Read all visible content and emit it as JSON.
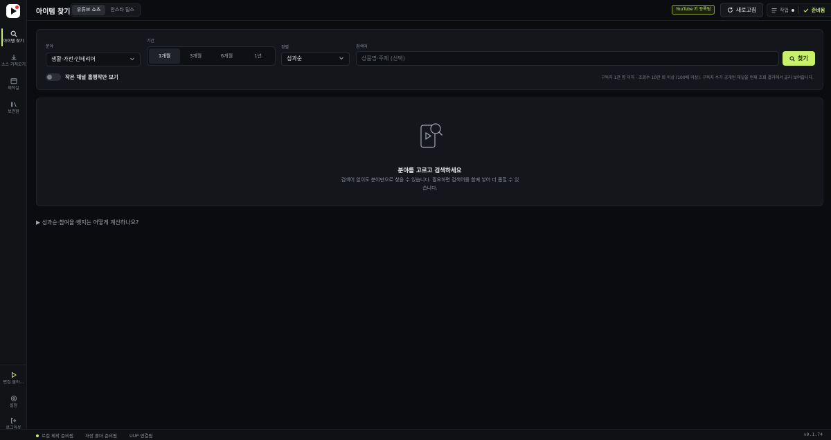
{
  "sidebar": {
    "items": [
      {
        "label": "아이템 찾기",
        "icon": "search-icon"
      },
      {
        "label": "소스 가져오기",
        "icon": "download-icon"
      },
      {
        "label": "제작실",
        "icon": "calendar-icon"
      },
      {
        "label": "보관함",
        "icon": "library-icon"
      }
    ],
    "bottom": [
      {
        "label": "편집 둘아…",
        "icon": "play-icon"
      },
      {
        "label": "설정",
        "icon": "gear-icon"
      },
      {
        "label": "로그아웃",
        "icon": "logout-icon"
      }
    ],
    "accent": "#c9f06a"
  },
  "header": {
    "title": "아이템 찾기",
    "tabs": [
      {
        "label": "유튜브 쇼츠"
      },
      {
        "label": "인스타 릴스"
      }
    ],
    "youtube_badge": "YouTube 키 등록됨",
    "refresh_label": "새로고침",
    "task_label": "작업",
    "status_label": "준비됨"
  },
  "filters": {
    "category_label": "분야",
    "category_value": "생활·가전·인테리어",
    "period_label": "기간",
    "periods": [
      {
        "label": "1개월"
      },
      {
        "label": "3개월"
      },
      {
        "label": "6개월"
      },
      {
        "label": "1년"
      }
    ],
    "sort_label": "정렬",
    "sort_value": "성과순",
    "keyword_label": "검색어",
    "keyword_placeholder": "상품명·주제 (선택)",
    "find_label": "찾기",
    "toggle_label": "작은 채널 홈행작만 보기",
    "hint": "구독자 1천 명 이하 · 조회수 10만 회 이상 (100배 이상). 구독자 수가 공개된 채널을 현재 조회 결과에서 골라 보여줍니다."
  },
  "empty_state": {
    "title": "분야를 고르고 검색하세요",
    "description": "검색어 없이도 분야만으로 찾을 수 있습니다. 필요하면 검색어를 함께 넣어 더 좁힐 수 있습니다."
  },
  "faq": {
    "label": "▶ 성과순·참여율·벳지는 어떻게 계산하나요?"
  },
  "statusbar": {
    "items": [
      {
        "label": "로컬 제작 준비됨"
      },
      {
        "label": "저장 폴더 준비됨"
      },
      {
        "label": "UUP 연결됨"
      }
    ],
    "version": "v0.1.74"
  }
}
